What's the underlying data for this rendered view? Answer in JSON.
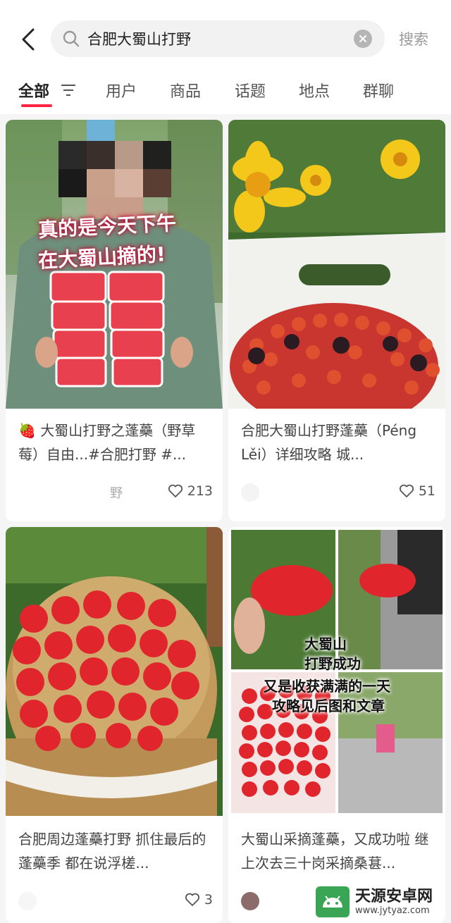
{
  "search": {
    "query": "合肥大蜀山打野",
    "button_label": "搜索"
  },
  "tabs": [
    {
      "label": "全部",
      "active": true
    },
    {
      "label": "用户"
    },
    {
      "label": "商品"
    },
    {
      "label": "话题"
    },
    {
      "label": "地点"
    },
    {
      "label": "群聊"
    }
  ],
  "notes": [
    {
      "title": "🍓 大蜀山打野之蓬蘽（野草莓）自由...#合肥打野 #...",
      "author": "野",
      "likes": "213",
      "overlay": [
        "真的是今天下午",
        "在大蜀山摘的!"
      ]
    },
    {
      "title": "合肥大蜀山打野蓬蘽（Péng Lěi）详细攻略 城...",
      "author": "",
      "likes": "51"
    },
    {
      "title": "合肥周边蓬蘽打野 抓住最后的蓬蘽季 都在说浮槎...",
      "author": "",
      "likes": "3"
    },
    {
      "title": "大蜀山采摘蓬蘽，又成功啦 继上次去三十岗采摘桑葚...",
      "author": "",
      "likes": "",
      "overlay": [
        "大蜀山",
        "打野成功",
        "又是收获满满的一天",
        "攻略见后图和文章"
      ]
    }
  ],
  "watermark": {
    "name": "天源安卓网",
    "url": "www.jytyaz.com"
  },
  "colors": {
    "accent": "#ff2442",
    "berry": "#e0262c"
  }
}
